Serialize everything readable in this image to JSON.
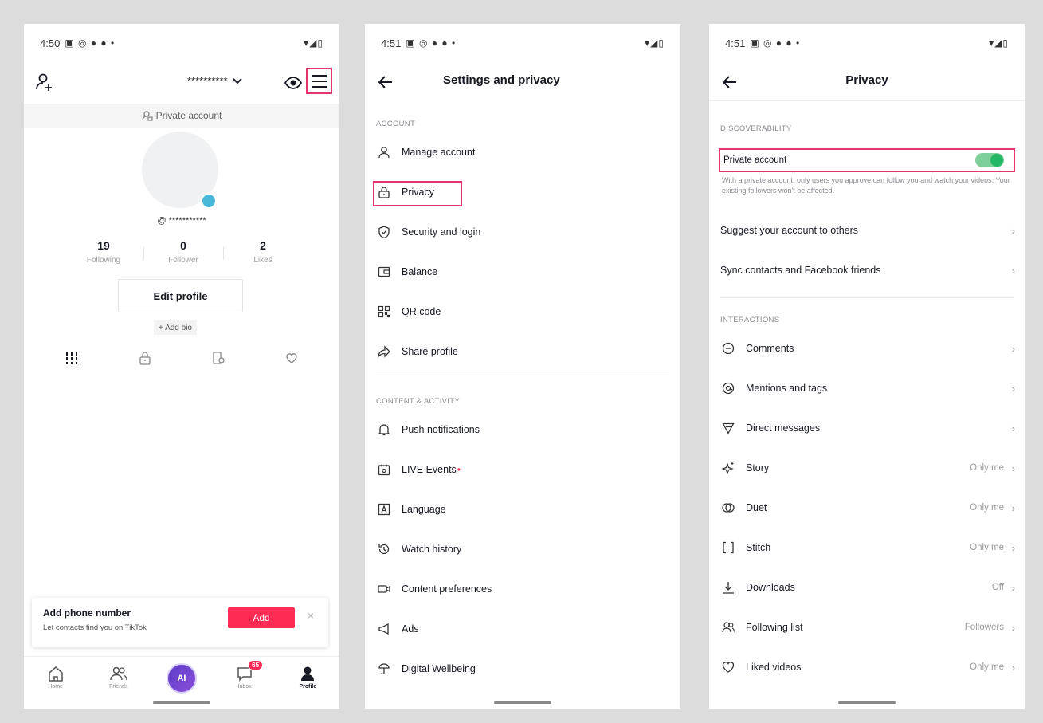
{
  "panel1": {
    "status_time": "4:50",
    "status_icons": "▣ ◎ ● ● •",
    "status_right": "▾◢▯",
    "username_masked": "**********",
    "private_account_label": "Private account",
    "handle": "@ ***********",
    "stats": [
      {
        "value": "19",
        "label": "Following"
      },
      {
        "value": "0",
        "label": "Follower"
      },
      {
        "value": "2",
        "label": "Likes"
      }
    ],
    "edit_profile": "Edit profile",
    "add_bio": "+ Add bio",
    "phone_card": {
      "title": "Add phone number",
      "subtitle": "Let contacts find you on TikTok",
      "add_button": "Add",
      "close": "×"
    },
    "nav": {
      "home": "Home",
      "friends": "Friends",
      "center": "AI",
      "inbox": "Inbox",
      "inbox_badge": "65",
      "profile": "Profile"
    },
    "accent_color": "#fe2c55",
    "highlight_color": "#e6336b"
  },
  "panel2": {
    "status_time": "4:51",
    "status_icons": "▣ ◎ ● ● •",
    "status_right": "▾◢▯",
    "title": "Settings and privacy",
    "section_account": "ACCOUNT",
    "section_content": "CONTENT & ACTIVITY",
    "items": {
      "manage_account": "Manage account",
      "privacy": "Privacy",
      "security": "Security and login",
      "balance": "Balance",
      "qr_code": "QR code",
      "share_profile": "Share profile",
      "push_notifications": "Push notifications",
      "live_events": "LIVE Events",
      "live_dot": "•",
      "language": "Language",
      "watch_history": "Watch history",
      "content_preferences": "Content preferences",
      "ads": "Ads",
      "digital_wellbeing": "Digital Wellbeing"
    }
  },
  "panel3": {
    "status_time": "4:51",
    "status_icons": "▣ ◎ ● ● •",
    "status_right": "▾◢▯",
    "title": "Privacy",
    "section_discoverability": "DISCOVERABILITY",
    "private_account": "Private account",
    "private_account_on": true,
    "private_desc": "With a private account, only users you approve can follow you and watch your videos. Your existing followers won't be affected.",
    "suggest": "Suggest your account to others",
    "sync": "Sync contacts and Facebook friends",
    "section_interactions": "INTERACTIONS",
    "interactions": {
      "comments": "Comments",
      "mentions": "Mentions and tags",
      "direct_messages": "Direct messages",
      "story": "Story",
      "story_val": "Only me",
      "duet": "Duet",
      "duet_val": "Only me",
      "stitch": "Stitch",
      "stitch_val": "Only me",
      "downloads": "Downloads",
      "downloads_val": "Off",
      "following_list": "Following list",
      "following_list_val": "Followers",
      "liked_videos": "Liked videos",
      "liked_videos_val": "Only me"
    },
    "chevron": "›"
  }
}
